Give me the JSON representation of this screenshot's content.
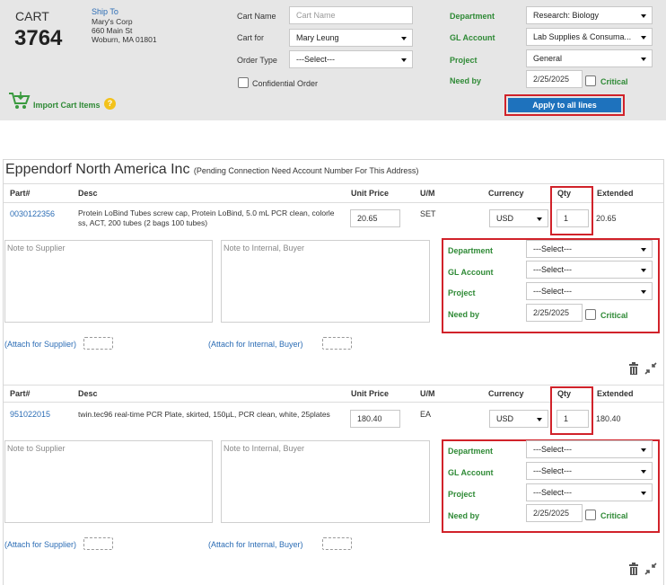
{
  "header": {
    "cart_label": "CART",
    "cart_number": "3764",
    "ship_to": {
      "title": "Ship To",
      "lines": [
        "Mary's Corp",
        "660 Main St",
        "Woburn, MA 01801"
      ]
    },
    "cart_name": {
      "label": "Cart Name",
      "placeholder": "Cart Name"
    },
    "cart_for": {
      "label": "Cart for",
      "value": "Mary Leung"
    },
    "order_type": {
      "label": "Order Type",
      "value": "---Select---"
    },
    "confidential_label": "Confidential Order",
    "department": {
      "label": "Department",
      "value": "Research: Biology"
    },
    "gl_account": {
      "label": "GL Account",
      "value": "Lab Supplies & Consuma..."
    },
    "project": {
      "label": "Project",
      "value": "General"
    },
    "need_by": {
      "label": "Need by",
      "value": "2/25/2025"
    },
    "critical_label": "Critical",
    "apply_button": "Apply to all lines",
    "import_label": "Import Cart Items",
    "help_glyph": "?"
  },
  "supplier": {
    "name": "Eppendorf North America Inc",
    "note": "(Pending Connection Need Account Number For This Address)"
  },
  "columns": {
    "part": "Part#",
    "desc": "Desc",
    "unit_price": "Unit Price",
    "um": "U/M",
    "currency": "Currency",
    "qty": "Qty",
    "extended": "Extended"
  },
  "lines": [
    {
      "part": "0030122356",
      "desc_1": "Protein LoBind Tubes screw cap, Protein LoBind, 5.0 mL PCR clean, colorle",
      "desc_2": "ss, ACT, 200 tubes (2 bags 100 tubes)",
      "unit_price": "20.65",
      "um": "SET",
      "currency": "USD",
      "qty": "1",
      "extended": "20.65",
      "note_supplier_placeholder": "Note to Supplier",
      "note_internal_placeholder": "Note to Internal, Buyer",
      "department_label": "Department",
      "department_value": "---Select---",
      "gl_label": "GL Account",
      "gl_value": "---Select---",
      "project_label": "Project",
      "project_value": "---Select---",
      "need_by_label": "Need by",
      "need_by_value": "2/25/2025",
      "critical_label": "Critical",
      "attach_supplier": "(Attach for Supplier)",
      "attach_internal": "(Attach for Internal, Buyer)"
    },
    {
      "part": "951022015",
      "desc_1": "twin.tec96 real-time PCR Plate, skirted, 150µL, PCR clean, white, 25plates",
      "desc_2": "",
      "unit_price": "180.40",
      "um": "EA",
      "currency": "USD",
      "qty": "1",
      "extended": "180.40",
      "note_supplier_placeholder": "Note to Supplier",
      "note_internal_placeholder": "Note to Internal, Buyer",
      "department_label": "Department",
      "department_value": "---Select---",
      "gl_label": "GL Account",
      "gl_value": "---Select---",
      "project_label": "Project",
      "project_value": "---Select---",
      "need_by_label": "Need by",
      "need_by_value": "2/25/2025",
      "critical_label": "Critical",
      "attach_supplier": "(Attach for Supplier)",
      "attach_internal": "(Attach for Internal, Buyer)"
    }
  ],
  "icons": {
    "trash": "trash-icon",
    "collapse": "collapse-icon",
    "cart": "cart-icon"
  },
  "colors": {
    "accent_blue": "#1e72bd",
    "highlight_red": "#d1222a",
    "label_green": "#2f8a36",
    "link_blue": "#2c6db5"
  }
}
